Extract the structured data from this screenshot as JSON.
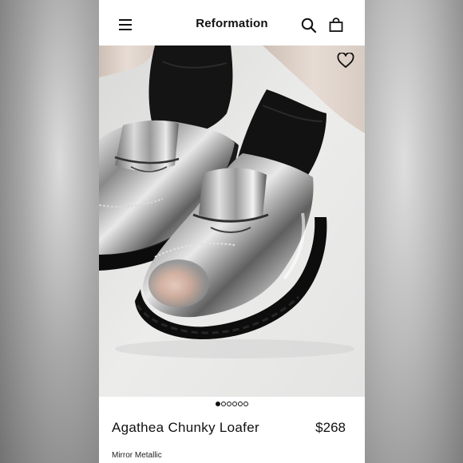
{
  "header": {
    "brand": "Reformation",
    "menu_icon": "hamburger-menu-icon",
    "search_icon": "search-icon",
    "bag_icon": "shopping-bag-icon"
  },
  "product": {
    "name": "Agathea Chunky Loafer",
    "price": "$268",
    "color": "Mirror Metallic",
    "wishlist_icon": "heart-outline-icon"
  },
  "gallery": {
    "image_count": 6,
    "active_index": 0,
    "dots": [
      true,
      false,
      false,
      false,
      false,
      false
    ]
  },
  "colors": {
    "background": "#ffffff",
    "text": "#111111",
    "photo_bg": "#e9e9e8"
  }
}
